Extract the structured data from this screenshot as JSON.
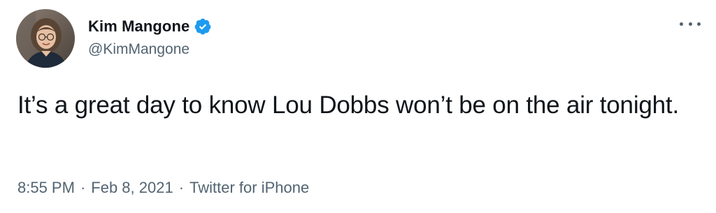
{
  "author": {
    "display_name": "Kim Mangone",
    "handle": "@KimMangone",
    "verified": true
  },
  "tweet": {
    "text": "It’s a great day to know Lou Dobbs won’t be on the air tonight."
  },
  "meta": {
    "time": "8:55 PM",
    "separator": "·",
    "date": "Feb 8, 2021",
    "source": "Twitter for iPhone"
  },
  "colors": {
    "verified_badge": "#1d9bf0",
    "secondary_text": "#536471",
    "primary_text": "#0f1419"
  },
  "icons": {
    "more": "more-options-icon",
    "verified": "verified-badge-icon"
  }
}
